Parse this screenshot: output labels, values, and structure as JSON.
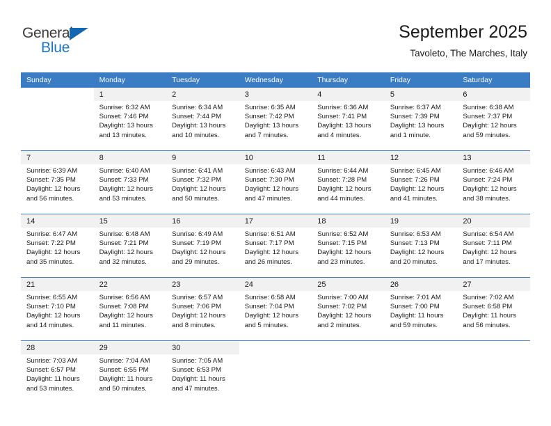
{
  "brand": {
    "name_top": "General",
    "name_bottom": "Blue",
    "color_dark": "#3b3b3b",
    "color_blue": "#1b76c8"
  },
  "header": {
    "title": "September 2025",
    "subtitle": "Tavoleto, The Marches, Italy"
  },
  "theme": {
    "header_row_bg": "#3b7dc4",
    "daynum_bg": "#f1f1f1",
    "divider": "#3b7dc4",
    "text": "#1a1a1a"
  },
  "weekdays": [
    "Sunday",
    "Monday",
    "Tuesday",
    "Wednesday",
    "Thursday",
    "Friday",
    "Saturday"
  ],
  "weeks": [
    [
      {
        "day": "",
        "sunrise": "",
        "sunset": "",
        "daylight": ""
      },
      {
        "day": "1",
        "sunrise": "Sunrise: 6:32 AM",
        "sunset": "Sunset: 7:46 PM",
        "daylight": "Daylight: 13 hours and 13 minutes."
      },
      {
        "day": "2",
        "sunrise": "Sunrise: 6:34 AM",
        "sunset": "Sunset: 7:44 PM",
        "daylight": "Daylight: 13 hours and 10 minutes."
      },
      {
        "day": "3",
        "sunrise": "Sunrise: 6:35 AM",
        "sunset": "Sunset: 7:42 PM",
        "daylight": "Daylight: 13 hours and 7 minutes."
      },
      {
        "day": "4",
        "sunrise": "Sunrise: 6:36 AM",
        "sunset": "Sunset: 7:41 PM",
        "daylight": "Daylight: 13 hours and 4 minutes."
      },
      {
        "day": "5",
        "sunrise": "Sunrise: 6:37 AM",
        "sunset": "Sunset: 7:39 PM",
        "daylight": "Daylight: 13 hours and 1 minute."
      },
      {
        "day": "6",
        "sunrise": "Sunrise: 6:38 AM",
        "sunset": "Sunset: 7:37 PM",
        "daylight": "Daylight: 12 hours and 59 minutes."
      }
    ],
    [
      {
        "day": "7",
        "sunrise": "Sunrise: 6:39 AM",
        "sunset": "Sunset: 7:35 PM",
        "daylight": "Daylight: 12 hours and 56 minutes."
      },
      {
        "day": "8",
        "sunrise": "Sunrise: 6:40 AM",
        "sunset": "Sunset: 7:33 PM",
        "daylight": "Daylight: 12 hours and 53 minutes."
      },
      {
        "day": "9",
        "sunrise": "Sunrise: 6:41 AM",
        "sunset": "Sunset: 7:32 PM",
        "daylight": "Daylight: 12 hours and 50 minutes."
      },
      {
        "day": "10",
        "sunrise": "Sunrise: 6:43 AM",
        "sunset": "Sunset: 7:30 PM",
        "daylight": "Daylight: 12 hours and 47 minutes."
      },
      {
        "day": "11",
        "sunrise": "Sunrise: 6:44 AM",
        "sunset": "Sunset: 7:28 PM",
        "daylight": "Daylight: 12 hours and 44 minutes."
      },
      {
        "day": "12",
        "sunrise": "Sunrise: 6:45 AM",
        "sunset": "Sunset: 7:26 PM",
        "daylight": "Daylight: 12 hours and 41 minutes."
      },
      {
        "day": "13",
        "sunrise": "Sunrise: 6:46 AM",
        "sunset": "Sunset: 7:24 PM",
        "daylight": "Daylight: 12 hours and 38 minutes."
      }
    ],
    [
      {
        "day": "14",
        "sunrise": "Sunrise: 6:47 AM",
        "sunset": "Sunset: 7:22 PM",
        "daylight": "Daylight: 12 hours and 35 minutes."
      },
      {
        "day": "15",
        "sunrise": "Sunrise: 6:48 AM",
        "sunset": "Sunset: 7:21 PM",
        "daylight": "Daylight: 12 hours and 32 minutes."
      },
      {
        "day": "16",
        "sunrise": "Sunrise: 6:49 AM",
        "sunset": "Sunset: 7:19 PM",
        "daylight": "Daylight: 12 hours and 29 minutes."
      },
      {
        "day": "17",
        "sunrise": "Sunrise: 6:51 AM",
        "sunset": "Sunset: 7:17 PM",
        "daylight": "Daylight: 12 hours and 26 minutes."
      },
      {
        "day": "18",
        "sunrise": "Sunrise: 6:52 AM",
        "sunset": "Sunset: 7:15 PM",
        "daylight": "Daylight: 12 hours and 23 minutes."
      },
      {
        "day": "19",
        "sunrise": "Sunrise: 6:53 AM",
        "sunset": "Sunset: 7:13 PM",
        "daylight": "Daylight: 12 hours and 20 minutes."
      },
      {
        "day": "20",
        "sunrise": "Sunrise: 6:54 AM",
        "sunset": "Sunset: 7:11 PM",
        "daylight": "Daylight: 12 hours and 17 minutes."
      }
    ],
    [
      {
        "day": "21",
        "sunrise": "Sunrise: 6:55 AM",
        "sunset": "Sunset: 7:10 PM",
        "daylight": "Daylight: 12 hours and 14 minutes."
      },
      {
        "day": "22",
        "sunrise": "Sunrise: 6:56 AM",
        "sunset": "Sunset: 7:08 PM",
        "daylight": "Daylight: 12 hours and 11 minutes."
      },
      {
        "day": "23",
        "sunrise": "Sunrise: 6:57 AM",
        "sunset": "Sunset: 7:06 PM",
        "daylight": "Daylight: 12 hours and 8 minutes."
      },
      {
        "day": "24",
        "sunrise": "Sunrise: 6:58 AM",
        "sunset": "Sunset: 7:04 PM",
        "daylight": "Daylight: 12 hours and 5 minutes."
      },
      {
        "day": "25",
        "sunrise": "Sunrise: 7:00 AM",
        "sunset": "Sunset: 7:02 PM",
        "daylight": "Daylight: 12 hours and 2 minutes."
      },
      {
        "day": "26",
        "sunrise": "Sunrise: 7:01 AM",
        "sunset": "Sunset: 7:00 PM",
        "daylight": "Daylight: 11 hours and 59 minutes."
      },
      {
        "day": "27",
        "sunrise": "Sunrise: 7:02 AM",
        "sunset": "Sunset: 6:58 PM",
        "daylight": "Daylight: 11 hours and 56 minutes."
      }
    ],
    [
      {
        "day": "28",
        "sunrise": "Sunrise: 7:03 AM",
        "sunset": "Sunset: 6:57 PM",
        "daylight": "Daylight: 11 hours and 53 minutes."
      },
      {
        "day": "29",
        "sunrise": "Sunrise: 7:04 AM",
        "sunset": "Sunset: 6:55 PM",
        "daylight": "Daylight: 11 hours and 50 minutes."
      },
      {
        "day": "30",
        "sunrise": "Sunrise: 7:05 AM",
        "sunset": "Sunset: 6:53 PM",
        "daylight": "Daylight: 11 hours and 47 minutes."
      },
      {
        "day": "",
        "sunrise": "",
        "sunset": "",
        "daylight": ""
      },
      {
        "day": "",
        "sunrise": "",
        "sunset": "",
        "daylight": ""
      },
      {
        "day": "",
        "sunrise": "",
        "sunset": "",
        "daylight": ""
      },
      {
        "day": "",
        "sunrise": "",
        "sunset": "",
        "daylight": ""
      }
    ]
  ]
}
